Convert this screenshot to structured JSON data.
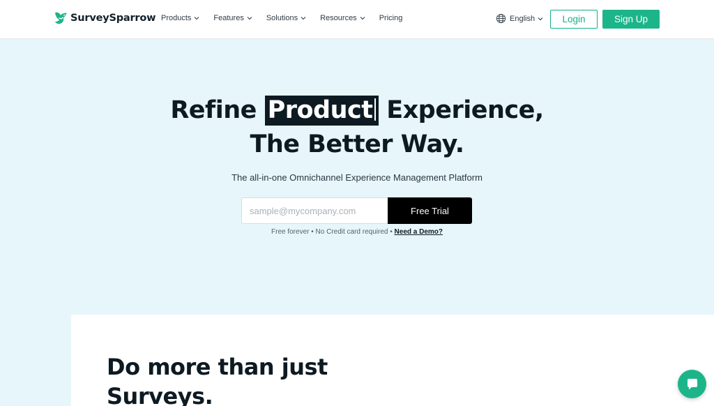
{
  "brand": {
    "name": "SurveySparrow",
    "icon": "sparrow-logo",
    "accent_color": "#1cb58a"
  },
  "nav": {
    "items": [
      {
        "label": "Products",
        "has_dropdown": true
      },
      {
        "label": "Features",
        "has_dropdown": true
      },
      {
        "label": "Solutions",
        "has_dropdown": true
      },
      {
        "label": "Resources",
        "has_dropdown": true
      },
      {
        "label": "Pricing",
        "has_dropdown": false
      }
    ],
    "language": "English",
    "login_label": "Login",
    "signup_label": "Sign Up"
  },
  "hero": {
    "title_prefix": "Refine",
    "title_highlight": "Product",
    "title_suffix": "Experience,",
    "title_line2": "The Better Way.",
    "subtitle": "The all-in-one Omnichannel Experience Management Platform",
    "email_placeholder": "sample@mycompany.com",
    "cta_label": "Free Trial",
    "note_text": "Free forever • No Credit card required •",
    "demo_link": "Need a Demo?"
  },
  "section": {
    "heading_line1": "Do more than just",
    "heading_line2": "Surveys."
  },
  "chat": {
    "icon": "chat-icon"
  }
}
